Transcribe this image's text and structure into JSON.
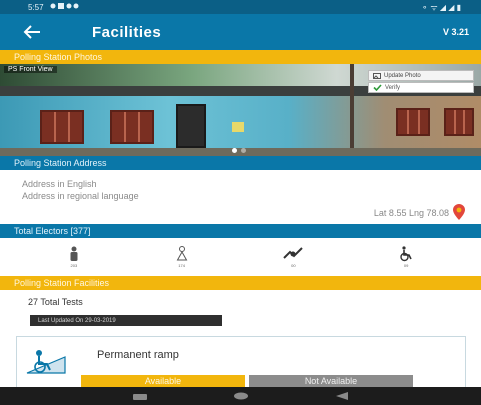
{
  "status_bar": {
    "time": "5:57",
    "right_text": "⚬ ᯤ ◢ ◢ ▮"
  },
  "app_bar": {
    "title": "Facilities",
    "version": "V 3.21"
  },
  "photos": {
    "header": "Polling Station Photos",
    "tag": "PS Front View",
    "upload_label": "Update Photo",
    "verify_label": "Verify"
  },
  "address": {
    "header": "Polling Station Address",
    "english": "Address in English",
    "regional": "Address in regional language",
    "latlng": "Lat 8.55 Lng 78.08"
  },
  "electors": {
    "header": "Total Electors [377]",
    "items": [
      {
        "icon": "male-icon",
        "count": "203"
      },
      {
        "icon": "female-icon",
        "count": "174"
      },
      {
        "icon": "third-gender-icon",
        "count": "00"
      },
      {
        "icon": "pwd-icon",
        "count": "09"
      }
    ]
  },
  "facilities": {
    "header": "Polling Station Facilities",
    "total_tests": "27 Total Tests",
    "last_updated": "Last Updated On 29-03-2019",
    "card_title": "Permanent ramp",
    "available_label": "Available",
    "not_available_label": "Not Available"
  },
  "colors": {
    "primary": "#0a77a8",
    "accent": "#f2b60d",
    "gray": "#8c8c8c"
  }
}
